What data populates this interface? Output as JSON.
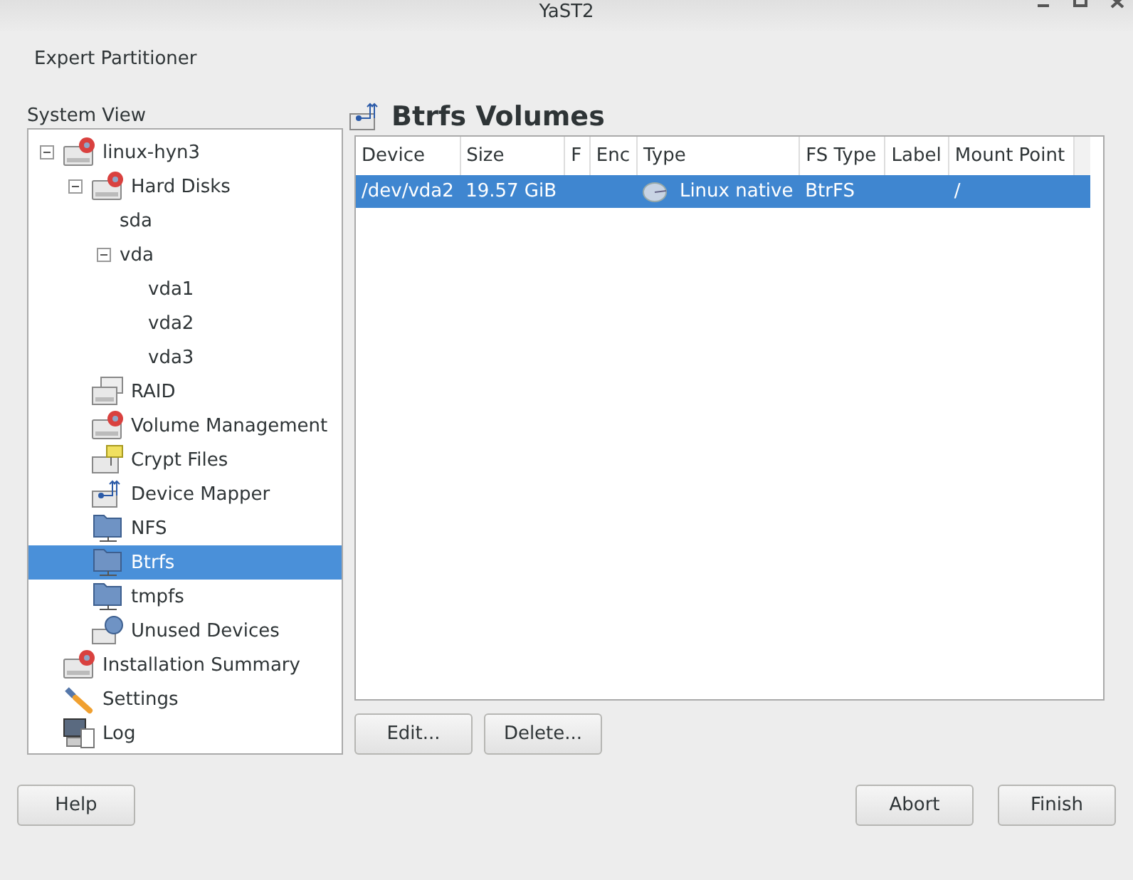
{
  "window": {
    "title": "YaST2"
  },
  "heading": "Expert Partitioner",
  "sidebar": {
    "label": "System View",
    "tree": [
      {
        "label": "linux-hyn3",
        "kind": "disk",
        "expanded": true,
        "selected": false,
        "children": [
          {
            "label": "Hard Disks",
            "kind": "disk",
            "expanded": true,
            "selected": false,
            "children": [
              {
                "label": "sda",
                "selected": false
              },
              {
                "label": "vda",
                "expanded": true,
                "selected": false,
                "children": [
                  {
                    "label": "vda1",
                    "selected": false
                  },
                  {
                    "label": "vda2",
                    "selected": false
                  },
                  {
                    "label": "vda3",
                    "selected": false
                  }
                ]
              }
            ]
          },
          {
            "label": "RAID",
            "kind": "raid",
            "selected": false
          },
          {
            "label": "Volume Management",
            "kind": "disk",
            "selected": false
          },
          {
            "label": "Crypt Files",
            "kind": "crypt",
            "selected": false
          },
          {
            "label": "Device Mapper",
            "kind": "mapper",
            "selected": false
          },
          {
            "label": "NFS",
            "kind": "folder",
            "selected": false
          },
          {
            "label": "Btrfs",
            "kind": "folder",
            "selected": true
          },
          {
            "label": "tmpfs",
            "kind": "folder",
            "selected": false
          },
          {
            "label": "Unused Devices",
            "kind": "unused",
            "selected": false
          }
        ]
      },
      {
        "label": "Installation Summary",
        "kind": "disk",
        "selected": false
      },
      {
        "label": "Settings",
        "kind": "settings",
        "selected": false
      },
      {
        "label": "Log",
        "kind": "log",
        "selected": false
      }
    ]
  },
  "panel": {
    "title": "Btrfs Volumes",
    "table": {
      "columns": [
        "Device",
        "Size",
        "F",
        "Enc",
        "Type",
        "FS Type",
        "Label",
        "Mount Point"
      ],
      "rows": [
        {
          "cells": [
            "/dev/vda2",
            "19.57 GiB",
            "",
            "",
            "Linux native",
            "BtrFS",
            "",
            "/"
          ],
          "selected": true
        }
      ]
    },
    "buttons": [
      "Edit...",
      "Delete..."
    ]
  },
  "footer": {
    "left": [
      "Help"
    ],
    "right": [
      "Abort",
      "Finish"
    ]
  }
}
